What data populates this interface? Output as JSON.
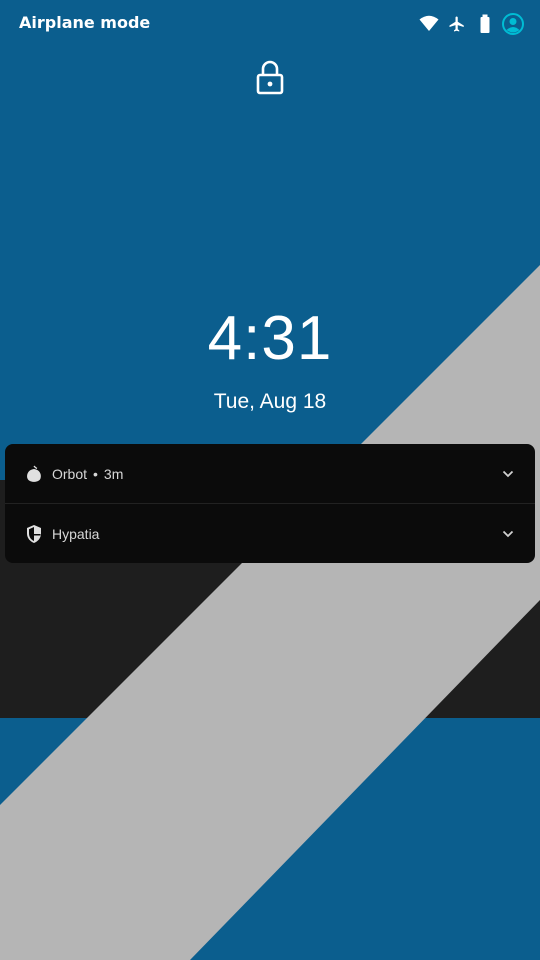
{
  "status_bar": {
    "title": "Airplane mode",
    "icons": [
      "wifi-icon",
      "airplane-icon",
      "battery-icon",
      "account-icon"
    ]
  },
  "lock_icon": "lock-icon",
  "clock": {
    "time": "4:31",
    "date": "Tue, Aug 18"
  },
  "notifications": [
    {
      "app": "Orbot",
      "time": "3m",
      "separator": "•",
      "icon": "onion-icon"
    },
    {
      "app": "Hypatia",
      "icon": "shield-icon"
    }
  ],
  "colors": {
    "wallpaper_blue": "#0b5e8e",
    "wallpaper_gray": "#b5b5b5",
    "wallpaper_dark": "#1e1e1e",
    "notification_bg": "#0b0b0b",
    "accent": "#00bcd4"
  }
}
